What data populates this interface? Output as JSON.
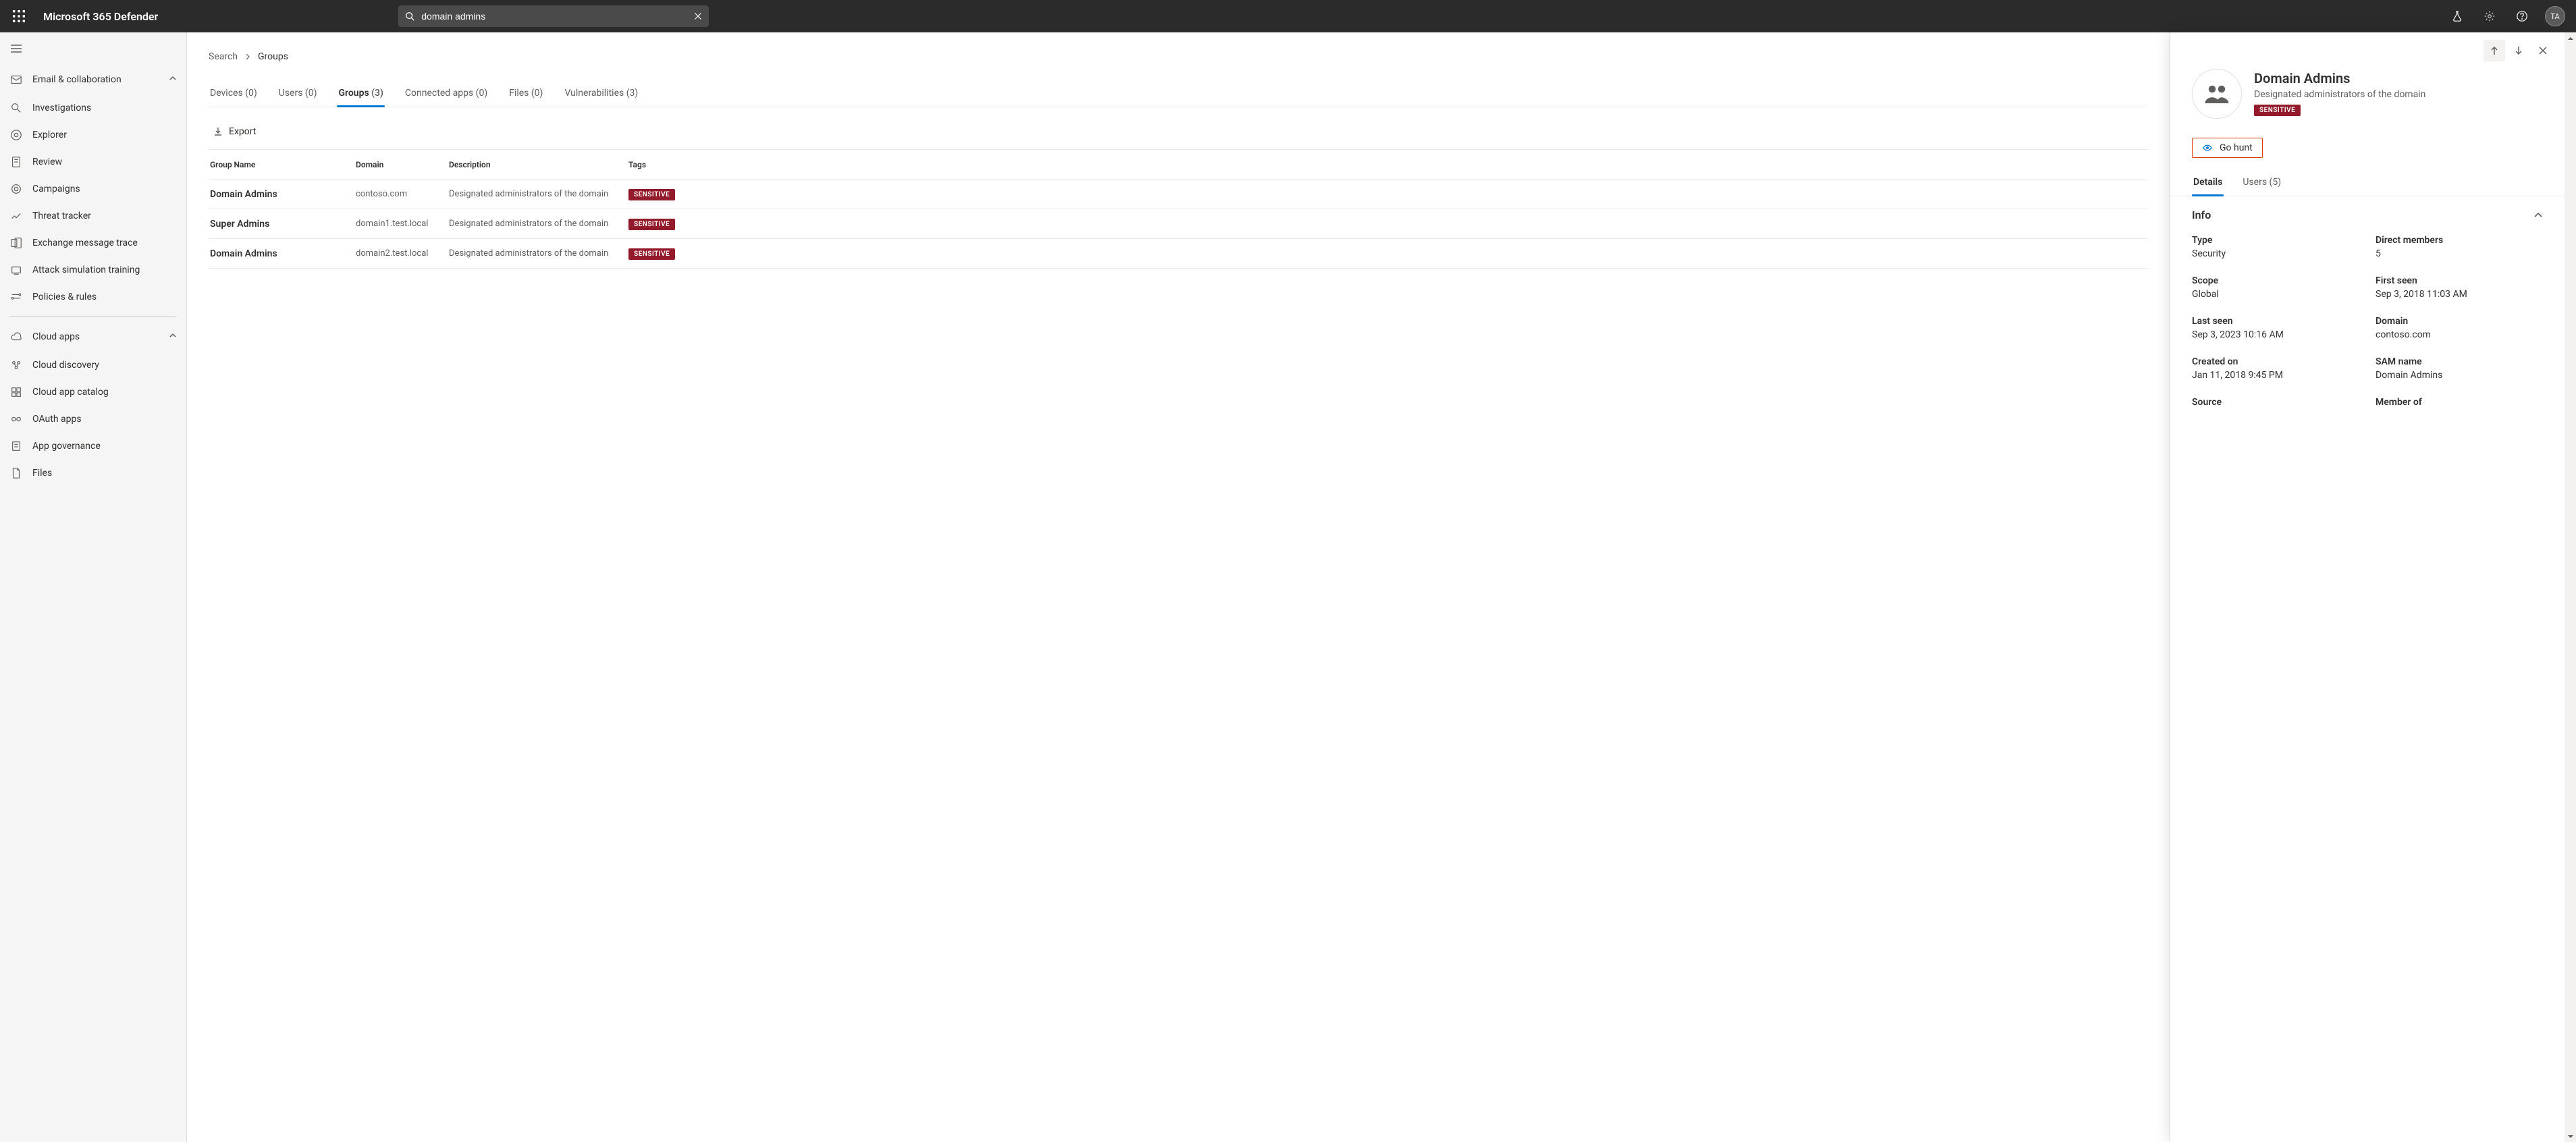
{
  "product_name": "Microsoft 365 Defender",
  "search": {
    "value": "domain admins"
  },
  "avatar": "TA",
  "nav": {
    "section1": {
      "label": "Email & collaboration",
      "expanded": true,
      "items": [
        {
          "label": "Investigations"
        },
        {
          "label": "Explorer"
        },
        {
          "label": "Review"
        },
        {
          "label": "Campaigns"
        },
        {
          "label": "Threat tracker"
        },
        {
          "label": "Exchange message trace"
        },
        {
          "label": "Attack simulation training"
        },
        {
          "label": "Policies & rules"
        }
      ]
    },
    "section2": {
      "label": "Cloud apps",
      "expanded": true,
      "items": [
        {
          "label": "Cloud discovery"
        },
        {
          "label": "Cloud app catalog"
        },
        {
          "label": "OAuth apps"
        },
        {
          "label": "App governance"
        },
        {
          "label": "Files"
        }
      ]
    }
  },
  "breadcrumb": {
    "root": "Search",
    "current": "Groups"
  },
  "tabs": [
    {
      "label": "Devices",
      "count": "(0)"
    },
    {
      "label": "Users",
      "count": "(0)"
    },
    {
      "label": "Groups",
      "count": "(3)",
      "active": true
    },
    {
      "label": "Connected apps",
      "count": "(0)"
    },
    {
      "label": "Files",
      "count": "(0)"
    },
    {
      "label": "Vulnerabilities",
      "count": "(3)"
    }
  ],
  "toolbar": {
    "export": "Export"
  },
  "table": {
    "headers": {
      "name": "Group Name",
      "domain": "Domain",
      "desc": "Description",
      "tags": "Tags"
    },
    "rows": [
      {
        "name": "Domain Admins",
        "domain": "contoso.com",
        "desc": "Designated administrators of the domain",
        "tag": "SENSITIVE"
      },
      {
        "name": "Super Admins",
        "domain": "domain1.test.local",
        "desc": "Designated administrators of the domain",
        "tag": "SENSITIVE"
      },
      {
        "name": "Domain Admins",
        "domain": "domain2.test.local",
        "desc": "Designated administrators of the domain",
        "tag": "SENSITIVE"
      }
    ]
  },
  "panel": {
    "title": "Domain Admins",
    "subtitle": "Designated administrators of the domain",
    "badge": "SENSITIVE",
    "go_hunt": "Go hunt",
    "tabs": [
      {
        "label": "Details",
        "active": true
      },
      {
        "label": "Users (5)"
      }
    ],
    "section_info": "Info",
    "info": {
      "type_label": "Type",
      "type_value": "Security",
      "members_label": "Direct members",
      "members_value": "5",
      "scope_label": "Scope",
      "scope_value": "Global",
      "firstseen_label": "First seen",
      "firstseen_value": "Sep 3, 2018 11:03 AM",
      "lastseen_label": "Last seen",
      "lastseen_value": "Sep 3, 2023 10:16 AM",
      "domain_label": "Domain",
      "domain_value": "contoso.com",
      "created_label": "Created on",
      "created_value": "Jan 11, 2018 9:45 PM",
      "sam_label": "SAM name",
      "sam_value": "Domain Admins",
      "source_label": "Source",
      "member_label": "Member of"
    }
  }
}
